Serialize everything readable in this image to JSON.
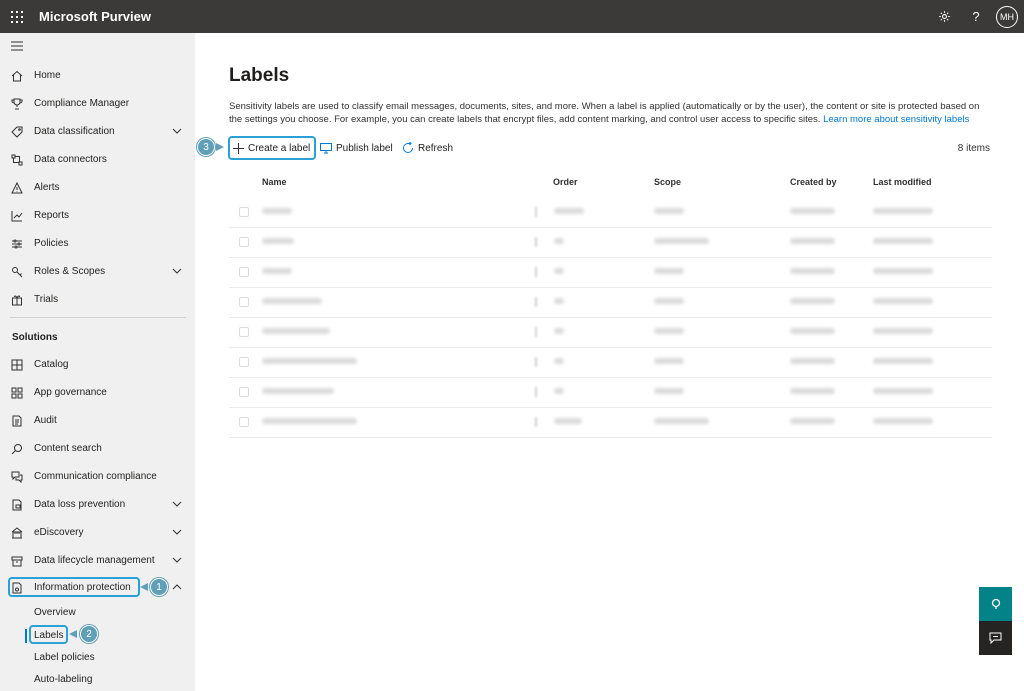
{
  "app": {
    "title": "Microsoft Purview",
    "user_initials": "MH"
  },
  "nav": {
    "items": [
      {
        "label": "Home",
        "icon": "home-icon"
      },
      {
        "label": "Compliance Manager",
        "icon": "trophy-icon"
      },
      {
        "label": "Data classification",
        "icon": "tag-icon",
        "expandable": true
      },
      {
        "label": "Data connectors",
        "icon": "connector-icon"
      },
      {
        "label": "Alerts",
        "icon": "alert-icon"
      },
      {
        "label": "Reports",
        "icon": "chart-icon"
      },
      {
        "label": "Policies",
        "icon": "sliders-icon"
      },
      {
        "label": "Roles & Scopes",
        "icon": "key-icon",
        "expandable": true
      },
      {
        "label": "Trials",
        "icon": "gift-icon"
      }
    ],
    "solutions_header": "Solutions",
    "solutions": [
      {
        "label": "Catalog",
        "icon": "catalog-icon"
      },
      {
        "label": "App governance",
        "icon": "apps-icon"
      },
      {
        "label": "Audit",
        "icon": "audit-icon"
      },
      {
        "label": "Content search",
        "icon": "search-icon"
      },
      {
        "label": "Communication compliance",
        "icon": "chat-icon"
      },
      {
        "label": "Data loss prevention",
        "icon": "dlp-icon",
        "expandable": true
      },
      {
        "label": "eDiscovery",
        "icon": "ediscovery-icon",
        "expandable": true
      },
      {
        "label": "Data lifecycle management",
        "icon": "lifecycle-icon",
        "expandable": true
      },
      {
        "label": "Information protection",
        "icon": "protection-icon",
        "expanded": true
      }
    ],
    "subitems": [
      {
        "label": "Overview"
      },
      {
        "label": "Labels",
        "selected": true
      },
      {
        "label": "Label policies"
      },
      {
        "label": "Auto-labeling"
      }
    ]
  },
  "main": {
    "title": "Labels",
    "description": "Sensitivity labels are used to classify email messages, documents, sites, and more. When a label is applied (automatically or by the user), the content or site is protected based on the settings you choose. For example, you can create labels that encrypt files, add content marking, and control user access to specific sites.",
    "learn_more": "Learn more about sensitivity labels",
    "toolbar": {
      "create": "Create a label",
      "publish": "Publish label",
      "refresh": "Refresh"
    },
    "items_count": "8 items",
    "columns": [
      "Name",
      "Order",
      "Scope",
      "Created by",
      "Last modified"
    ],
    "row_count": 8
  },
  "callouts": {
    "step1": "1",
    "step2": "2",
    "step3": "3"
  },
  "colors": {
    "topbar": "#3b3a39",
    "sidebar": "#f0f0f0",
    "accent": "#0078d4",
    "callout": "#29a1d6",
    "step_badge": "#5f9fb8",
    "help_button": "#038387",
    "chat_button": "#252423"
  }
}
